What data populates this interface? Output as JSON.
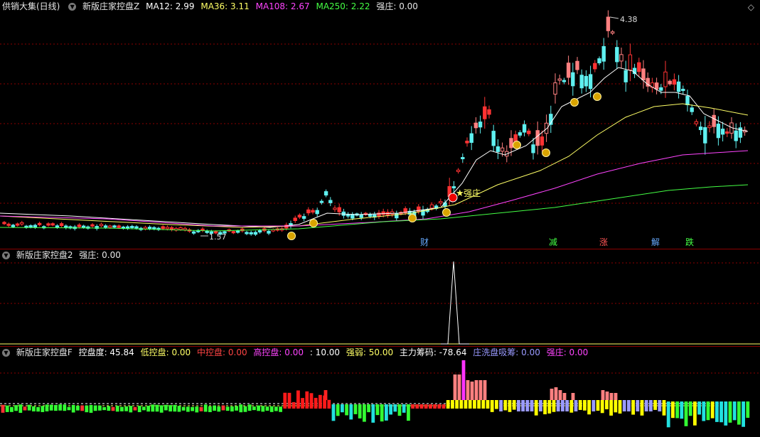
{
  "window": {
    "title": "供销大集(日线)",
    "maximize_icon": "diamond-icon"
  },
  "main_pane": {
    "indicator": "新版庄家控盘Z",
    "ma": [
      {
        "label": "MA12: 2.99",
        "color": "#ffffff"
      },
      {
        "label": "MA36: 3.11",
        "color": "#ffff66"
      },
      {
        "label": "MA108: 2.67",
        "color": "#ff44ff"
      },
      {
        "label": "MA250: 2.22",
        "color": "#44ff44"
      }
    ],
    "qz": "强庄: 0.00",
    "high_label": "4.38",
    "low_label": "1.57",
    "signal_label": "强庄",
    "events": [
      {
        "text": "财",
        "color": "#66aaff"
      },
      {
        "text": "减",
        "color": "#44ff44"
      },
      {
        "text": "涨",
        "color": "#ff5555"
      },
      {
        "text": "解",
        "color": "#66aaff"
      },
      {
        "text": "跌",
        "color": "#44ff44"
      }
    ],
    "bull_color": "#ff3333",
    "bear_color": "#5ff0f0"
  },
  "pane2": {
    "indicator": "新版庄家控盘2",
    "qz": "强庄: 0.00"
  },
  "pane3": {
    "indicator": "新版庄家控盘F",
    "items": [
      {
        "label": "控盘度: 45.84",
        "color": "#ffffff"
      },
      {
        "label": "低控盘: 0.00",
        "color": "#ffff66"
      },
      {
        "label": "中控盘: 0.00",
        "color": "#ff4444"
      },
      {
        "label": "高控盘: 0.00",
        "color": "#ff44ff"
      },
      {
        "label": ": 10.00",
        "color": "#ffffff"
      },
      {
        "label": "强弱: 50.00",
        "color": "#ffff66"
      },
      {
        "label": "主力筹码: -78.64",
        "color": "#ffffff"
      },
      {
        "label": "庄洗盘吸筹: 0.00",
        "color": "#9999ff"
      },
      {
        "label": "强庄: 0.00",
        "color": "#ff44ff"
      }
    ]
  }
}
